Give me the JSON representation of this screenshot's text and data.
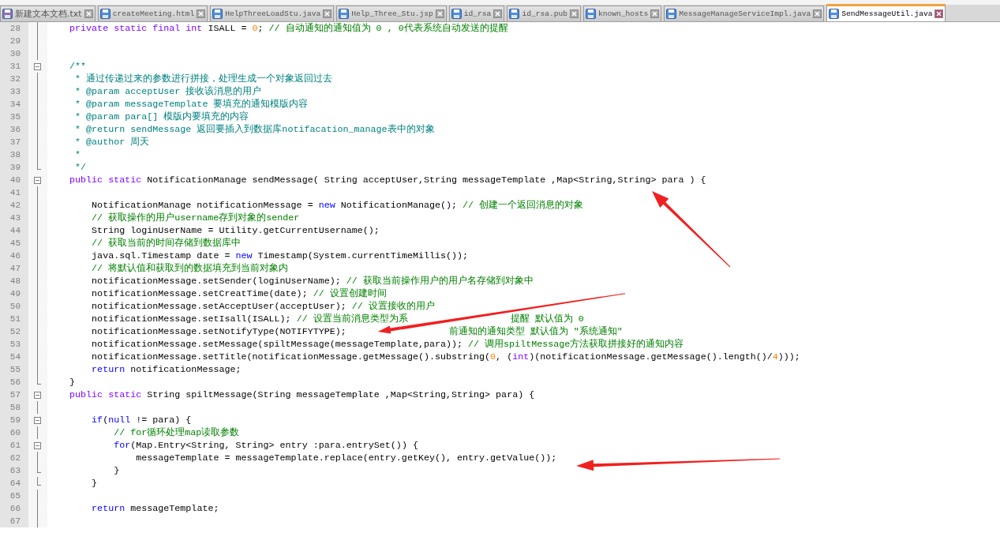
{
  "tabs": [
    {
      "label": "新建文本文档.txt",
      "selected": false,
      "readonly": true
    },
    {
      "label": "createMeeting.html",
      "selected": false,
      "readonly": false
    },
    {
      "label": "HelpThreeLoadStu.java",
      "selected": false,
      "readonly": false
    },
    {
      "label": "Help_Three_Stu.jsp",
      "selected": false,
      "readonly": false
    },
    {
      "label": "id_rsa",
      "selected": false,
      "readonly": false
    },
    {
      "label": "id_rsa.pub",
      "selected": false,
      "readonly": false
    },
    {
      "label": "known_hosts",
      "selected": false,
      "readonly": false
    },
    {
      "label": "MessageManageServiceImpl.java",
      "selected": false,
      "readonly": false
    },
    {
      "label": "SendMessageUtil.java",
      "selected": true,
      "readonly": false
    }
  ],
  "lines": [
    {
      "number": "28",
      "fold_start": false,
      "fold_end": false,
      "segments": [
        {
          "kind": "modifier",
          "text": "    private static final int"
        },
        {
          "kind": "plain",
          "text": " ISALL = "
        },
        {
          "kind": "number",
          "text": "0"
        },
        {
          "kind": "plain",
          "text": "; "
        },
        {
          "kind": "comment",
          "text": "// 自动通知的通知值为 0 , 0代表系统自动发送的提醒"
        }
      ]
    },
    {
      "number": "29",
      "fold_start": false,
      "fold_end": false
    },
    {
      "number": "30",
      "fold_start": false,
      "fold_end": false
    },
    {
      "number": "31",
      "fold_start": true,
      "fold_end": false,
      "segments": [
        {
          "kind": "doc",
          "text": "    /**"
        }
      ]
    },
    {
      "number": "32",
      "fold_start": false,
      "fold_end": false,
      "segments": [
        {
          "kind": "doc",
          "text": "     * 通过传递过来的参数进行拼接，处理生成一个对象返回过去"
        }
      ]
    },
    {
      "number": "33",
      "fold_start": false,
      "fold_end": false,
      "segments": [
        {
          "kind": "doc",
          "text": "     * @param acceptUser 接收该消息的用户"
        }
      ]
    },
    {
      "number": "34",
      "fold_start": false,
      "fold_end": false,
      "segments": [
        {
          "kind": "doc",
          "text": "     * @param messageTemplate 要填充的通知模版内容"
        }
      ]
    },
    {
      "number": "35",
      "fold_start": false,
      "fold_end": false,
      "segments": [
        {
          "kind": "doc",
          "text": "     * @param para[] 模版内要填充的内容"
        }
      ]
    },
    {
      "number": "36",
      "fold_start": false,
      "fold_end": false,
      "segments": [
        {
          "kind": "doc",
          "text": "     * @return sendMessage 返回要插入到数据库notifacation_manage表中的对象"
        }
      ]
    },
    {
      "number": "37",
      "fold_start": false,
      "fold_end": false,
      "segments": [
        {
          "kind": "doc",
          "text": "     * @author 周天"
        }
      ]
    },
    {
      "number": "38",
      "fold_start": false,
      "fold_end": false,
      "segments": [
        {
          "kind": "doc",
          "text": "     *"
        }
      ]
    },
    {
      "number": "39",
      "fold_start": false,
      "fold_end": true,
      "segments": [
        {
          "kind": "doc",
          "text": "     */"
        }
      ]
    },
    {
      "number": "40",
      "fold_start": true,
      "fold_end": false,
      "segments": [
        {
          "kind": "modifier",
          "text": "    public static"
        },
        {
          "kind": "plain",
          "text": " NotificationManage sendMessage( String acceptUser,String messageTemplate ,Map<String,String> para ) {"
        }
      ]
    },
    {
      "number": "41",
      "fold_start": false,
      "fold_end": false
    },
    {
      "number": "42",
      "fold_start": false,
      "fold_end": false,
      "segments": [
        {
          "kind": "plain",
          "text": "        NotificationManage notificationMessage = "
        },
        {
          "kind": "keyword",
          "text": "new"
        },
        {
          "kind": "plain",
          "text": " NotificationManage(); "
        },
        {
          "kind": "comment",
          "text": "// 创建一个返回消息的对象"
        }
      ]
    },
    {
      "number": "43",
      "fold_start": false,
      "fold_end": false,
      "segments": [
        {
          "kind": "comment",
          "text": "        // 获取操作的用户username存到对象的sender"
        }
      ]
    },
    {
      "number": "44",
      "fold_start": false,
      "fold_end": false,
      "segments": [
        {
          "kind": "plain",
          "text": "        String loginUserName = Utility.getCurrentUsername();"
        }
      ]
    },
    {
      "number": "45",
      "fold_start": false,
      "fold_end": false,
      "segments": [
        {
          "kind": "comment",
          "text": "        // 获取当前的时间存储到数据库中"
        }
      ]
    },
    {
      "number": "46",
      "fold_start": false,
      "fold_end": false,
      "segments": [
        {
          "kind": "plain",
          "text": "        java.sql.Timestamp date = "
        },
        {
          "kind": "keyword",
          "text": "new"
        },
        {
          "kind": "plain",
          "text": " Timestamp(System.currentTimeMillis());"
        }
      ]
    },
    {
      "number": "47",
      "fold_start": false,
      "fold_end": false,
      "segments": [
        {
          "kind": "comment",
          "text": "        // 将默认值和获取到的数据填充到当前对象内"
        }
      ]
    },
    {
      "number": "48",
      "fold_start": false,
      "fold_end": false,
      "segments": [
        {
          "kind": "plain",
          "text": "        notificationMessage.setSender(loginUserName); "
        },
        {
          "kind": "comment",
          "text": "// 获取当前操作用户的用户名存储到对象中"
        }
      ]
    },
    {
      "number": "49",
      "fold_start": false,
      "fold_end": false,
      "segments": [
        {
          "kind": "plain",
          "text": "        notificationMessage.setCreatTime(date); "
        },
        {
          "kind": "comment",
          "text": "// 设置创建时间"
        }
      ]
    },
    {
      "number": "50",
      "fold_start": false,
      "fold_end": false,
      "segments": [
        {
          "kind": "plain",
          "text": "        notificationMessage.setAcceptUser(acceptUser); "
        },
        {
          "kind": "comment",
          "text": "// 设置接收的用户"
        }
      ]
    },
    {
      "number": "51",
      "fold_start": false,
      "fold_end": false,
      "segments": [
        {
          "kind": "plain",
          "text": "        notificationMessage.setIsall(ISALL); "
        },
        {
          "kind": "comment",
          "text": "// 设置当前消息类型为系"
        },
        {
          "kind": "covered"
        },
        {
          "kind": "comment",
          "text": "提醒 默认值为 0"
        }
      ]
    },
    {
      "number": "52",
      "fold_start": false,
      "fold_end": false,
      "segments": [
        {
          "kind": "plain",
          "text": "        notificationMessage.setNotifyType(NOTIFYTYPE);"
        },
        {
          "kind": "covered"
        },
        {
          "kind": "comment",
          "text": "前通知的通知类型 默认值为 \"系统通知\""
        }
      ]
    },
    {
      "number": "53",
      "fold_start": false,
      "fold_end": false,
      "segments": [
        {
          "kind": "plain",
          "text": "        notificationMessage.setMessage(spiltMessage(messageTemplate,para)); "
        },
        {
          "kind": "comment",
          "text": "// 调用spiltMessage方法获取拼接好的通知内容"
        }
      ]
    },
    {
      "number": "54",
      "fold_start": false,
      "fold_end": false,
      "segments": [
        {
          "kind": "plain",
          "text": "        notificationMessage.setTitle(notificationMessage.getMessage().substring("
        },
        {
          "kind": "number",
          "text": "0"
        },
        {
          "kind": "plain",
          "text": ", ("
        },
        {
          "kind": "modifier",
          "text": "int"
        },
        {
          "kind": "plain",
          "text": ")(notificationMessage.getMessage().length()/"
        },
        {
          "kind": "number",
          "text": "4"
        },
        {
          "kind": "plain",
          "text": ")));"
        }
      ]
    },
    {
      "number": "55",
      "fold_start": false,
      "fold_end": false,
      "segments": [
        {
          "kind": "keyword",
          "text": "        return"
        },
        {
          "kind": "plain",
          "text": " notificationMessage;"
        }
      ]
    },
    {
      "number": "56",
      "fold_start": false,
      "fold_end": true,
      "segments": [
        {
          "kind": "plain",
          "text": "    }"
        }
      ]
    },
    {
      "number": "57",
      "fold_start": true,
      "fold_end": false,
      "segments": [
        {
          "kind": "modifier",
          "text": "    public static"
        },
        {
          "kind": "plain",
          "text": " String spiltMessage(String messageTemplate ,Map<String,String> para) {"
        }
      ]
    },
    {
      "number": "58",
      "fold_start": false,
      "fold_end": false
    },
    {
      "number": "59",
      "fold_start": true,
      "fold_end": false,
      "segments": [
        {
          "kind": "keyword",
          "text": "        if"
        },
        {
          "kind": "plain",
          "text": "("
        },
        {
          "kind": "keyword",
          "text": "null"
        },
        {
          "kind": "plain",
          "text": " != para) {"
        }
      ]
    },
    {
      "number": "60",
      "fold_start": false,
      "fold_end": false,
      "segments": [
        {
          "kind": "comment",
          "text": "            // for循环处理map读取参数"
        }
      ]
    },
    {
      "number": "61",
      "fold_start": true,
      "fold_end": false,
      "segments": [
        {
          "kind": "keyword",
          "text": "            for"
        },
        {
          "kind": "plain",
          "text": "(Map.Entry<String, String> entry :para.entrySet()) {"
        }
      ]
    },
    {
      "number": "62",
      "fold_start": false,
      "fold_end": false,
      "segments": [
        {
          "kind": "plain",
          "text": "                messageTemplate = messageTemplate.replace(entry.getKey(), entry.getValue());"
        }
      ]
    },
    {
      "number": "63",
      "fold_start": false,
      "fold_end": true,
      "segments": [
        {
          "kind": "plain",
          "text": "            }"
        }
      ]
    },
    {
      "number": "64",
      "fold_start": false,
      "fold_end": true,
      "segments": [
        {
          "kind": "plain",
          "text": "        }"
        }
      ]
    },
    {
      "number": "65",
      "fold_start": false,
      "fold_end": false
    },
    {
      "number": "66",
      "fold_start": false,
      "fold_end": false,
      "segments": [
        {
          "kind": "keyword",
          "text": "        return"
        },
        {
          "kind": "plain",
          "text": " messageTemplate;"
        }
      ]
    },
    {
      "number": "67",
      "fold_start": false,
      "fold_end": false
    }
  ]
}
